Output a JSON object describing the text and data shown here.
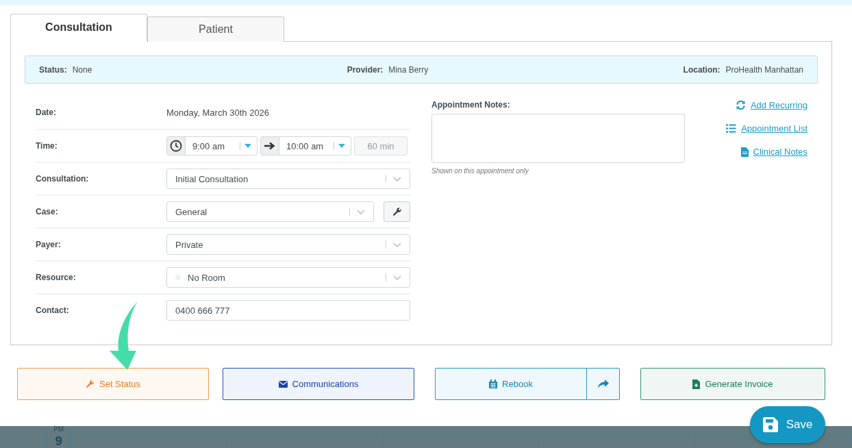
{
  "tabs": [
    {
      "label": "Consultation",
      "selected": true
    },
    {
      "label": "Patient",
      "selected": false
    }
  ],
  "info_bar": [
    {
      "label": "Status:",
      "value": "None"
    },
    {
      "label": "Provider:",
      "value": "Mina Berry"
    },
    {
      "label": "Location:",
      "value": "ProHealth Manhattan"
    }
  ],
  "form": [
    {
      "kind": "text",
      "label": "Date:",
      "value": "Monday, March 30th 2026"
    },
    {
      "kind": "time",
      "label": "Time:",
      "start": "9:00 am",
      "end": "10:00 am",
      "duration": "60 min"
    },
    {
      "kind": "select",
      "label": "Consultation:",
      "value": "Initial Consultation"
    },
    {
      "kind": "select_tool",
      "label": "Case:",
      "value": "General"
    },
    {
      "kind": "select",
      "label": "Payer:",
      "value": "Private"
    },
    {
      "kind": "select_dot",
      "label": "Resource:",
      "value": "No Room"
    },
    {
      "kind": "input",
      "label": "Contact:",
      "value": "0400 666 777"
    }
  ],
  "notes": {
    "label": "Appointment Notes:",
    "hint": "Shown on this appointment only"
  },
  "links": [
    {
      "kind": "recurring",
      "label": "Add Recurring"
    },
    {
      "kind": "list",
      "label": "Appointment List"
    },
    {
      "kind": "notes",
      "label": "Clinical Notes"
    }
  ],
  "actions": [
    {
      "kind": "status",
      "label": "Set Status"
    },
    {
      "kind": "communications",
      "label": "Communications"
    },
    {
      "kind": "rebook",
      "label": "Rebook"
    },
    {
      "kind": "invoice",
      "label": "Generate Invoice"
    }
  ],
  "save": "Save",
  "calendar": {
    "period": "PM",
    "hour": "9"
  }
}
